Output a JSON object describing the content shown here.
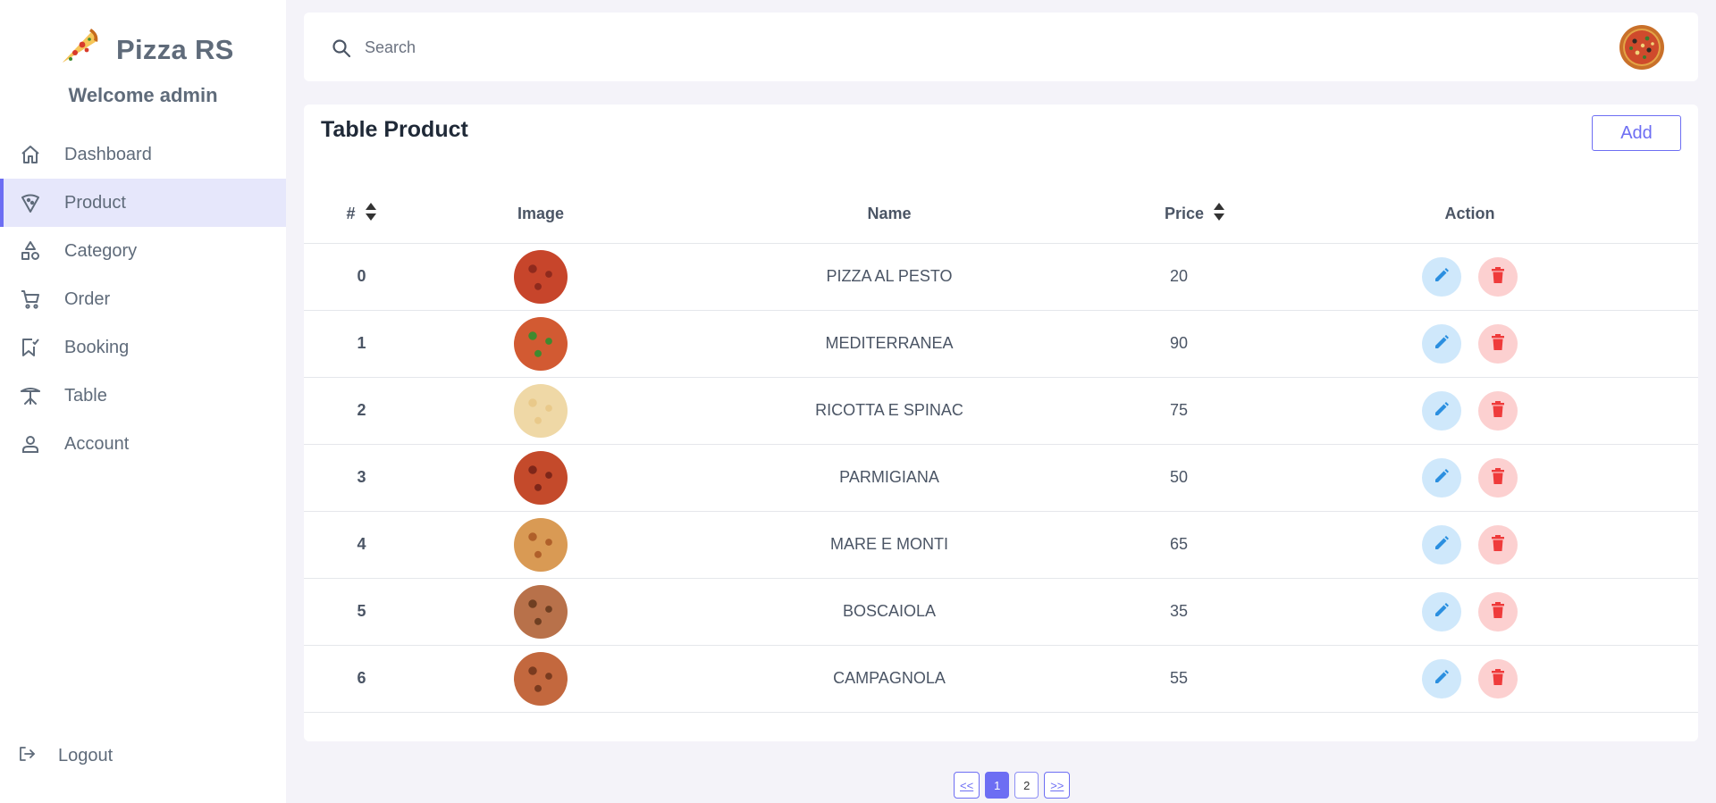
{
  "app": {
    "brand": "Pizza RS",
    "welcome": "Welcome admin"
  },
  "sidebar": {
    "items": [
      {
        "label": "Dashboard",
        "icon": "home-icon",
        "active": false
      },
      {
        "label": "Product",
        "icon": "pizza-slice-icon",
        "active": true
      },
      {
        "label": "Category",
        "icon": "shapes-icon",
        "active": false
      },
      {
        "label": "Order",
        "icon": "cart-icon",
        "active": false
      },
      {
        "label": "Booking",
        "icon": "bookmark-check-icon",
        "active": false
      },
      {
        "label": "Table",
        "icon": "table-icon",
        "active": false
      },
      {
        "label": "Account",
        "icon": "user-icon",
        "active": false
      }
    ],
    "logout": "Logout"
  },
  "search": {
    "placeholder": "Search",
    "value": ""
  },
  "product_table": {
    "title": "Table Product",
    "add_label": "Add",
    "columns": [
      "#",
      "Image",
      "Name",
      "Price",
      "Action"
    ],
    "rows": [
      {
        "index": "0",
        "name": "PIZZA AL PESTO",
        "price": "20"
      },
      {
        "index": "1",
        "name": "MEDITERRANEA",
        "price": "90"
      },
      {
        "index": "2",
        "name": "RICOTTA E SPINAC",
        "price": "75"
      },
      {
        "index": "3",
        "name": "PARMIGIANA",
        "price": "50"
      },
      {
        "index": "4",
        "name": "MARE E MONTI",
        "price": "65"
      },
      {
        "index": "5",
        "name": "BOSCAIOLA",
        "price": "35"
      },
      {
        "index": "6",
        "name": "CAMPAGNOLA",
        "price": "55"
      }
    ]
  },
  "pagination": {
    "first": "<<",
    "pages": [
      "1",
      "2"
    ],
    "current": "1",
    "last": ">>"
  },
  "colors": {
    "accent": "#6d6ef3",
    "edit": "#2b8fe0",
    "delete": "#ef3b3b"
  }
}
